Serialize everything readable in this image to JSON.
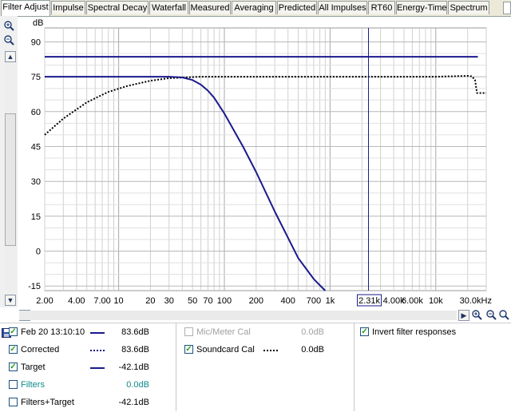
{
  "tabs": [
    {
      "label": "Filter Adjust",
      "active": true
    },
    {
      "label": "Impulse"
    },
    {
      "label": "Spectral Decay"
    },
    {
      "label": "Waterfall"
    },
    {
      "label": "Measured"
    },
    {
      "label": "Averaging"
    },
    {
      "label": "Predicted"
    },
    {
      "label": "All Impulses"
    },
    {
      "label": "RT60"
    },
    {
      "label": "Energy-Time"
    },
    {
      "label": "Spectrum"
    }
  ],
  "chart_data": {
    "type": "line",
    "ylabel": "dB",
    "x_scale": "log",
    "xlim": [
      2,
      30000
    ],
    "ylim": [
      -17,
      96
    ],
    "y_ticks": [
      90,
      75,
      60,
      45,
      30,
      15,
      0,
      -15
    ],
    "x_ticks": [
      {
        "value": 2,
        "label": "2.00"
      },
      {
        "value": 4,
        "label": "4.00"
      },
      {
        "value": 7,
        "label": "7.00"
      },
      {
        "value": 10,
        "label": "10"
      },
      {
        "value": 20,
        "label": "20"
      },
      {
        "value": 30,
        "label": "30"
      },
      {
        "value": 50,
        "label": "50"
      },
      {
        "value": 70,
        "label": "70"
      },
      {
        "value": 100,
        "label": "100"
      },
      {
        "value": 200,
        "label": "200"
      },
      {
        "value": 400,
        "label": "400"
      },
      {
        "value": 700,
        "label": "700"
      },
      {
        "value": 1000,
        "label": "1k"
      },
      {
        "value": 4000,
        "label": "4.00k"
      },
      {
        "value": 6000,
        "label": "6.00k"
      },
      {
        "value": 10000,
        "label": "10k"
      },
      {
        "value": 30000,
        "label": "30.0kHz"
      }
    ],
    "cursor": {
      "x": 2310,
      "label": "2.31k"
    },
    "series": [
      {
        "name": "Feb 20 13:10:10",
        "color": "#1a1a8c",
        "style": "solid",
        "x": [
          2,
          25000
        ],
        "y": [
          83.6,
          83.6
        ]
      },
      {
        "name": "Corrected",
        "color": "#000000",
        "style": "dotted",
        "x": [
          2,
          3,
          5,
          8,
          12,
          20,
          30,
          60,
          100,
          500,
          1000,
          5000,
          10000,
          20000,
          22000,
          23500,
          24500,
          30000
        ],
        "y": [
          50,
          57,
          64,
          68.5,
          71,
          73.3,
          74.4,
          75,
          75,
          75,
          75,
          75,
          75,
          75.4,
          75.2,
          73.5,
          68,
          68
        ]
      },
      {
        "name": "Target",
        "color": "#1a1a8c",
        "style": "solid",
        "x": [
          2,
          20,
          30,
          40,
          50,
          60,
          70,
          80,
          100,
          150,
          200,
          300,
          500,
          700,
          900
        ],
        "y": [
          75,
          75,
          75,
          74.7,
          73.6,
          71.6,
          69,
          66,
          59.2,
          45,
          34,
          17,
          -3,
          -12,
          -17
        ]
      }
    ]
  },
  "legend": {
    "left": [
      {
        "label": "Feb 20 13:10:10",
        "value": "83.6dB",
        "checked": true
      },
      {
        "label": "Corrected",
        "value": "83.6dB",
        "checked": true
      },
      {
        "label": "Target",
        "value": "-42.1dB",
        "checked": true
      },
      {
        "label": "Filters",
        "value": "0.0dB",
        "checked": false
      },
      {
        "label": "Filters+Target",
        "value": "-42.1dB",
        "checked": false
      }
    ],
    "middle": [
      {
        "label": "Mic/Meter Cal",
        "value": "0.0dB",
        "checked": false
      },
      {
        "label": "Soundcard Cal",
        "value": "0.0dB",
        "checked": true
      }
    ],
    "right": [
      {
        "label": "Invert filter responses",
        "checked": true
      }
    ]
  },
  "colors": {
    "series_blue": "#1a1a8c",
    "filters_teal": "#0e8a8a",
    "disabled_gray": "#a0a0a0",
    "check_green": "#21a121",
    "grid": "#c8c8c8"
  },
  "icons": {
    "zoom_in": "magnifier-plus-icon",
    "zoom_out": "magnifier-minus-icon",
    "scroll_up": "arrow-up-icon",
    "scroll_down": "arrow-down-icon",
    "scroll_left": "arrow-left-icon",
    "scroll_right": "arrow-right-icon"
  }
}
